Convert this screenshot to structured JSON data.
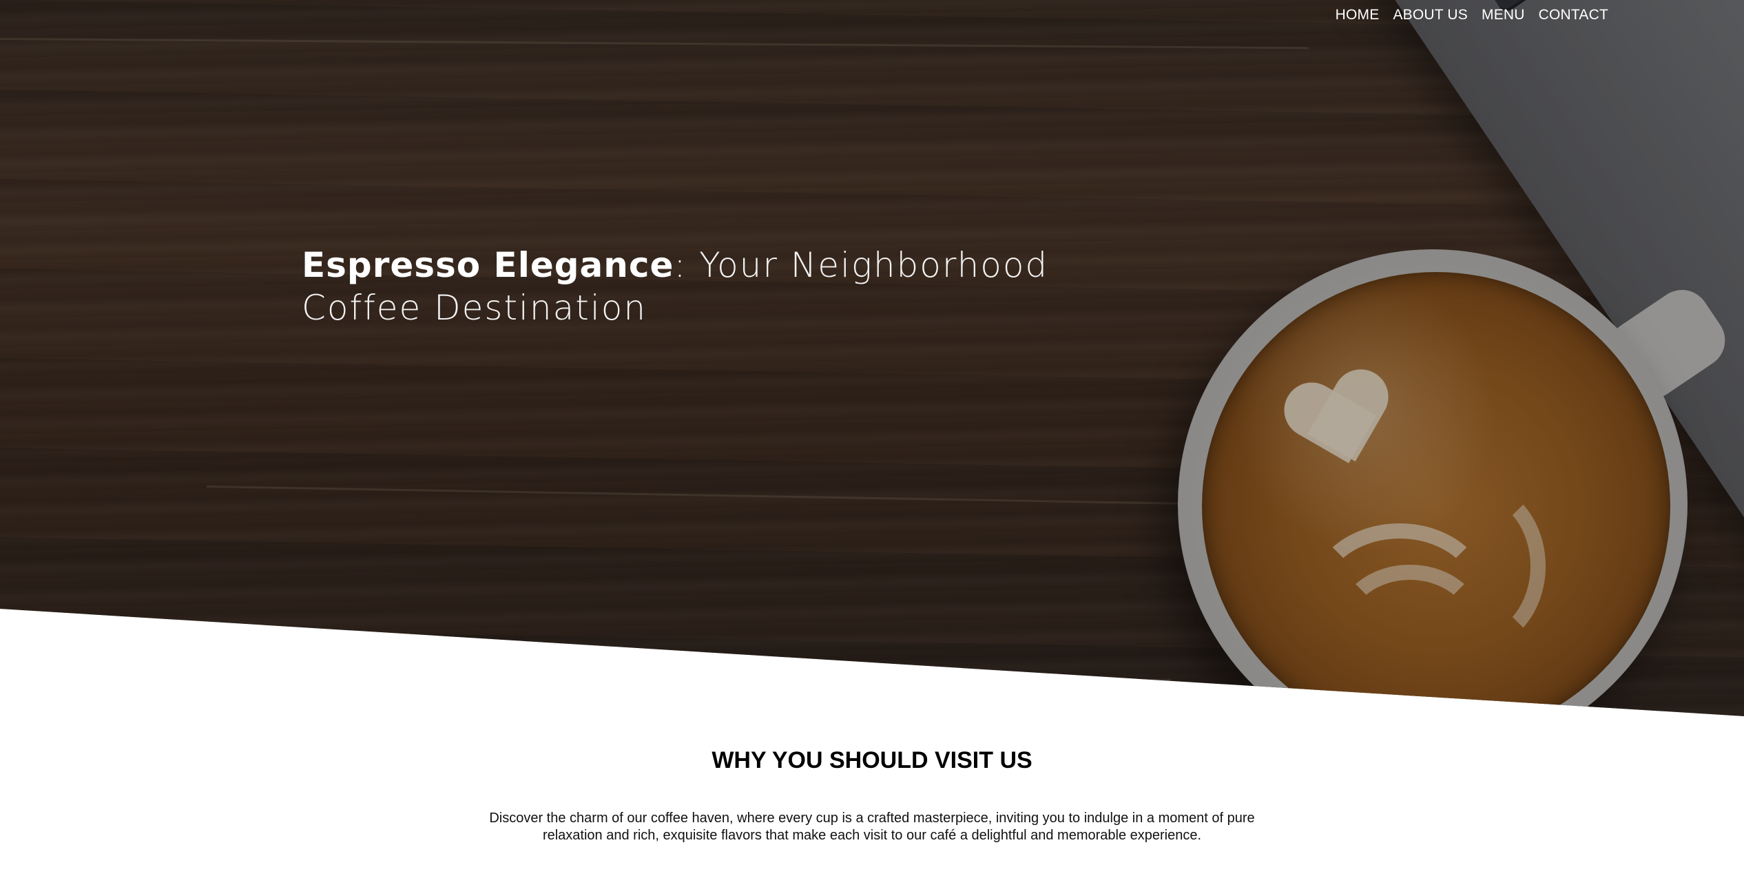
{
  "nav": {
    "items": [
      {
        "label": "HOME"
      },
      {
        "label": "ABOUT US"
      },
      {
        "label": "MENU"
      },
      {
        "label": "CONTACT"
      }
    ]
  },
  "hero": {
    "brand": "Espresso Elegance",
    "tagline": ": Your Neighborhood Coffee Destination"
  },
  "section": {
    "title": "WHY YOU SHOULD VISIT US",
    "description": "Discover the charm of our coffee haven, where every cup is a crafted masterpiece, inviting you to indulge in a moment of pure relaxation and rich, exquisite flavors that make each visit to our café a delightful and memorable experience."
  },
  "colors": {
    "text_light": "#ffffff",
    "text_dark": "#000000",
    "background": "#ffffff"
  }
}
